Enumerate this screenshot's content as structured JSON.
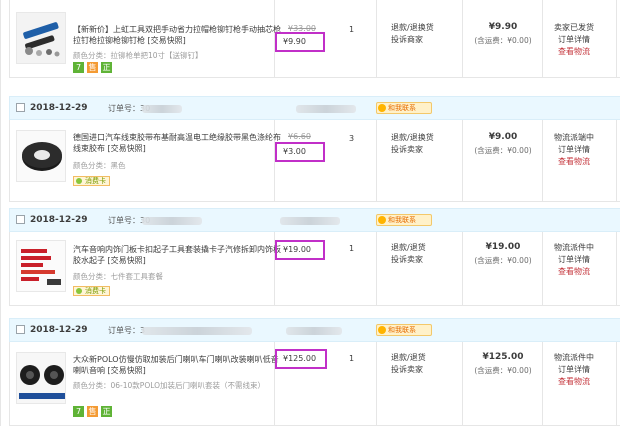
{
  "orders": [
    {
      "date": "",
      "order_label": "",
      "order_no": "",
      "contact_label": "",
      "title": "【新新价】上虹工具双把手动省力拉帽枪铆钉枪手动抽芯枪拉钉枪拉铆枪铆钉枪 [交易快照]",
      "spec": "颜色分类：拉铆枪单把10寸【送铆钉】",
      "tags": [
        "7",
        "售",
        "正"
      ],
      "original_price": "¥33.00",
      "price": "¥9.90",
      "quantity": "1",
      "service": [
        "退款/退换货",
        "投诉商家"
      ],
      "total": "¥9.90",
      "shipping": "(含运费：¥0.00)",
      "status": [
        "卖家已发货",
        "订单详情",
        "查看物流"
      ]
    },
    {
      "date": "2018-12-29",
      "order_label": "订单号：",
      "order_no": "30",
      "contact_label": "和我联系",
      "title": "德国进口汽车线束胶带布基耐高温电工绝缘胶带黑色涤纶布线束胶布 [交易快照]",
      "spec": "颜色分类：黑色",
      "tag_pill": "消费卡",
      "original_price": "¥6.60",
      "price": "¥3.00",
      "quantity": "3",
      "service": [
        "退款/退换货",
        "投诉卖家"
      ],
      "total": "¥9.00",
      "shipping": "(含运费：¥0.00)",
      "status": [
        "物流派端中",
        "订单详情",
        "查看物流"
      ]
    },
    {
      "date": "2018-12-29",
      "order_label": "订单号：",
      "order_no": "30",
      "contact_label": "和我联系",
      "title": "汽车音响内饰门板卡扣起子工具套装撬卡子汽修拆卸内饰板胶水起子 [交易快照]",
      "spec": "颜色分类：七件套工具套餐",
      "tag_pill": "消费卡",
      "original_price": "",
      "price": "¥19.00",
      "quantity": "1",
      "service": [
        "退款/退货",
        "投诉卖家"
      ],
      "total": "¥19.00",
      "shipping": "(含运费：¥0.00)",
      "status": [
        "物流派件中",
        "订单详情",
        "查看物流"
      ]
    },
    {
      "date": "2018-12-29",
      "order_label": "订单号：",
      "order_no": "3",
      "contact_label": "和我联系",
      "title": "大众新POLO仿慢仿取加装后门喇叭车门喇叭改装喇叭低音喇叭音响 [交易快照]",
      "spec": "颜色分类：06-10款POLO加装后门喇叭套装（不需线束）",
      "tags": [
        "7",
        "售",
        "正"
      ],
      "original_price": "",
      "price": "¥125.00",
      "quantity": "1",
      "service": [
        "退款/退货",
        "投诉卖家"
      ],
      "total": "¥125.00",
      "shipping": "(含运费：¥0.00)",
      "status": [
        "物流派件中",
        "订单详情",
        "查看物流"
      ]
    }
  ],
  "colors": {
    "highlight": "#c12fc8",
    "header_bg": "#eaf8ff",
    "link_red": "#c4333a"
  }
}
